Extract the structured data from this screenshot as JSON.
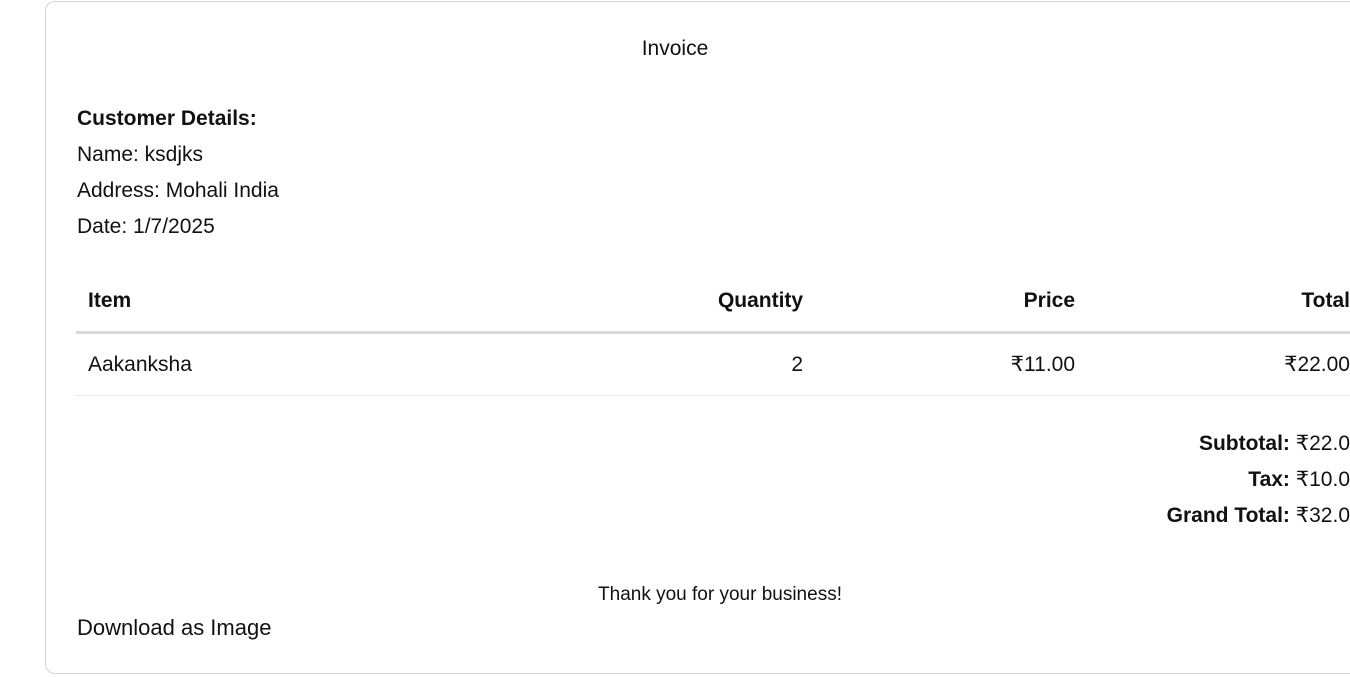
{
  "invoice": {
    "title": "Invoice",
    "customer": {
      "heading": "Customer Details:",
      "name_line": "Name: ksdjks",
      "address_line": "Address: Mohali India",
      "date_line": "Date: 1/7/2025"
    },
    "table": {
      "headers": {
        "item": "Item",
        "quantity": "Quantity",
        "price": "Price",
        "total": "Total"
      },
      "rows": [
        {
          "item": "Aakanksha",
          "quantity": "2",
          "price": "₹11.00",
          "total": "₹22.00"
        }
      ]
    },
    "totals": {
      "subtotal_label": "Subtotal:",
      "subtotal_value": "₹22.0",
      "tax_label": "Tax:",
      "tax_value": "₹10.0",
      "grand_total_label": "Grand Total:",
      "grand_total_value": "₹32.0"
    },
    "thank_you": "Thank you for your business!",
    "download_label": "Download as Image"
  }
}
